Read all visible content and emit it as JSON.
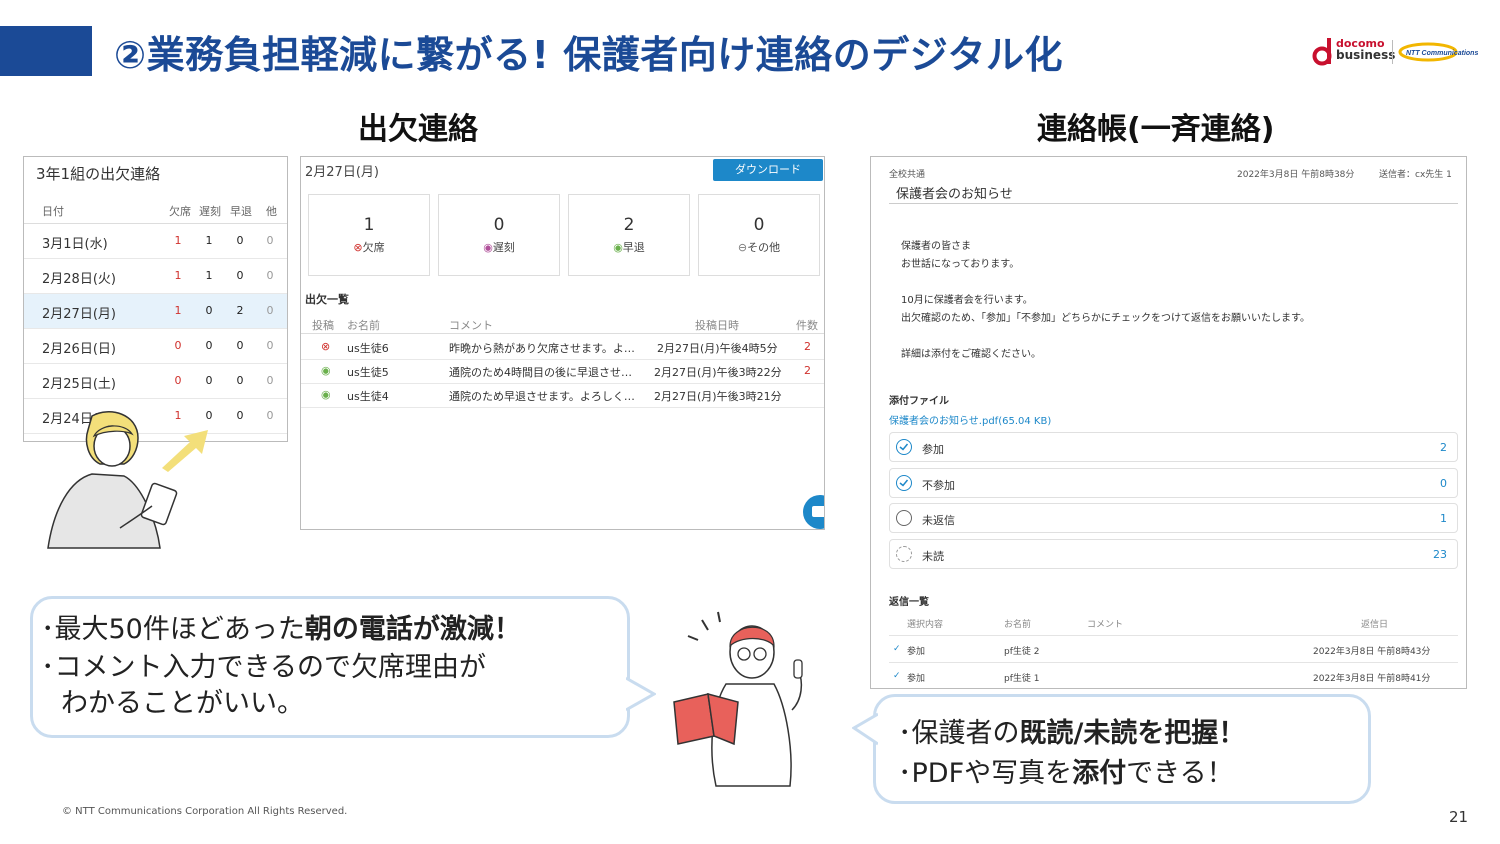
{
  "header": {
    "title": "②業務負担軽減に繋がる!  保護者向け連絡のデジタル化",
    "logo_docomo": "docomo",
    "logo_business": "business",
    "logo_ntt": "NTT Communications"
  },
  "sections": {
    "attendance_title": "出欠連絡",
    "notice_title": "連絡帳(一斉連絡)"
  },
  "attendance_panel": {
    "heading": "3年1組の出欠連絡",
    "columns": [
      "日付",
      "欠席",
      "遅刻",
      "早退",
      "他"
    ],
    "rows": [
      {
        "date": "3月1日(水)",
        "absent": "1",
        "late": "1",
        "early": "0",
        "other": "0"
      },
      {
        "date": "2月28日(火)",
        "absent": "1",
        "late": "1",
        "early": "0",
        "other": "0"
      },
      {
        "date": "2月27日(月)",
        "absent": "1",
        "late": "0",
        "early": "2",
        "other": "0"
      },
      {
        "date": "2月26日(日)",
        "absent": "0",
        "late": "0",
        "early": "0",
        "other": "0"
      },
      {
        "date": "2月25日(土)",
        "absent": "0",
        "late": "0",
        "early": "0",
        "other": "0"
      },
      {
        "date": "2月24日(金)",
        "absent": "1",
        "late": "0",
        "early": "0",
        "other": "0"
      }
    ]
  },
  "detail_panel": {
    "date": "2月27日(月)",
    "download_label": "ダウンロード",
    "stats": [
      {
        "value": "1",
        "label": "欠席"
      },
      {
        "value": "0",
        "label": "遅刻"
      },
      {
        "value": "2",
        "label": "早退"
      },
      {
        "value": "0",
        "label": "その他"
      }
    ],
    "list_title": "出欠一覧",
    "list_columns": [
      "投稿",
      "お名前",
      "コメント",
      "投稿日時",
      "件数"
    ],
    "list_rows": [
      {
        "name": "us生徒6",
        "comment": "昨晩から熱があり欠席させます。よ…",
        "posted": "2月27日(月)午後4時5分",
        "count": "2"
      },
      {
        "name": "us生徒5",
        "comment": "通院のため4時間目の後に早退させ…",
        "posted": "2月27日(月)午後3時22分",
        "count": "2"
      },
      {
        "name": "us生徒4",
        "comment": "通院のため早退させます。よろしく…",
        "posted": "2月27日(月)午後3時21分",
        "count": ""
      }
    ]
  },
  "notice_panel": {
    "scope": "全校共通",
    "datetime": "2022年3月8日 午前8時38分",
    "sender": "送信者：cx先生 1",
    "subject": "保護者会のお知らせ",
    "body_lines": [
      "保護者の皆さま",
      "お世話になっております。",
      "",
      "10月に保護者会を行います。",
      "出欠確認のため、「参加」「不参加」どちらかにチェックをつけて返信をお願いいたします。",
      "",
      "詳細は添付をご確認ください。"
    ],
    "attachment_label": "添付ファイル",
    "attachment_file": "保護者会のお知らせ.pdf(65.04 KB)",
    "options": [
      {
        "label": "参加",
        "count": "2"
      },
      {
        "label": "不参加",
        "count": "0"
      },
      {
        "label": "未返信",
        "count": "1"
      },
      {
        "label": "未読",
        "count": "23"
      }
    ],
    "reply_title": "返信一覧",
    "reply_columns": [
      "選択内容",
      "お名前",
      "コメント",
      "返信日"
    ],
    "replies": [
      {
        "choice": "参加",
        "name": "pf生徒 2",
        "date": "2022年3月8日 午前8時43分"
      },
      {
        "choice": "参加",
        "name": "pf生徒 1",
        "date": "2022年3月8日 午前8時41分"
      }
    ]
  },
  "bubble_left": {
    "l1_a": "･最大50件ほどあった",
    "l1_b": "朝の電話が激減！",
    "l2": "･コメント入力できるので欠席理由が",
    "l3": "わかることがいい。"
  },
  "bubble_right": {
    "l1_a": "･保護者の",
    "l1_b": "既読/未読を把握！",
    "l2_a": "･PDFや写真を",
    "l2_b": "添付",
    "l2_c": "できる！"
  },
  "footer": {
    "copyright": "© NTT Communications Corporation All Rights Reserved.",
    "page": "21"
  },
  "colors": {
    "brand_blue": "#1b4a96",
    "accent_blue": "#1d88c9",
    "absent_red": "#d0312d",
    "bubble_border": "#c9dcef",
    "arrow_yellow": "#f3df7a"
  }
}
